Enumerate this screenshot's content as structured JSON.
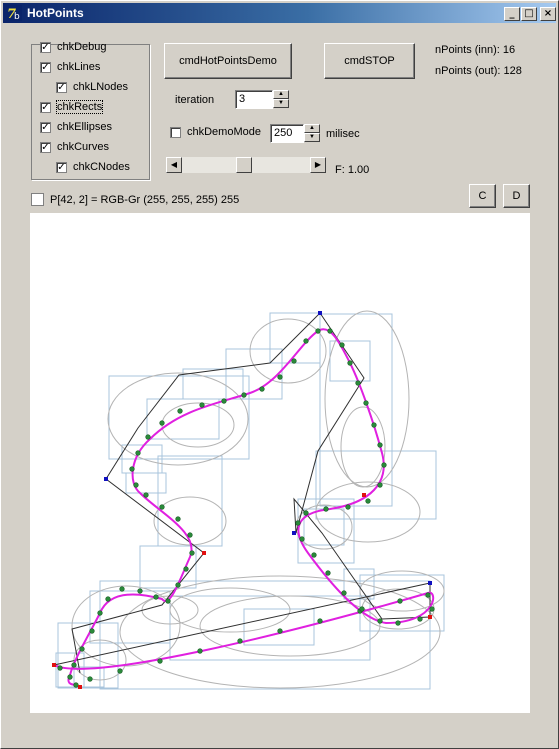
{
  "window": {
    "title": "HotPoints",
    "icon": "vb-app-icon",
    "controls": [
      "minimize-icon",
      "maximize-icon",
      "close-icon"
    ]
  },
  "checkboxes": {
    "debug": {
      "label": "chkDebug",
      "checked": true
    },
    "lines": {
      "label": "chkLines",
      "checked": true
    },
    "lnodes": {
      "label": "chkLNodes",
      "checked": true
    },
    "rects": {
      "label": "chkRects",
      "checked": true
    },
    "ellipses": {
      "label": "chkEllipses",
      "checked": true
    },
    "curves": {
      "label": "chkCurves",
      "checked": true
    },
    "cnodes": {
      "label": "chkCNodes",
      "checked": true
    },
    "demo": {
      "label": "chkDemoMode",
      "checked": false
    }
  },
  "buttons": {
    "demo": "cmdHotPointsDemo",
    "stop": "cmdSTOP",
    "c": "C",
    "d": "D"
  },
  "iteration": {
    "label": "iteration",
    "value": "3"
  },
  "demo_ms": {
    "value": "250",
    "unit": "milisec"
  },
  "slider": {
    "position": 0.48
  },
  "factor_label": "F: 1.00",
  "npoints_inn": "nPoints (inn): 16",
  "npoints_out": "nPoints (out): 128",
  "pixel_info": "P[42, 2] = RGB-Gr (255, 255, 255) 255",
  "colors": {
    "curve": "#e020e0",
    "node": "#2a8a3a",
    "rect": "#a8c4dc",
    "ellipse": "#b4b4b4",
    "line": "#303030",
    "end_red": "#e01010",
    "end_blue": "#1010c0"
  }
}
